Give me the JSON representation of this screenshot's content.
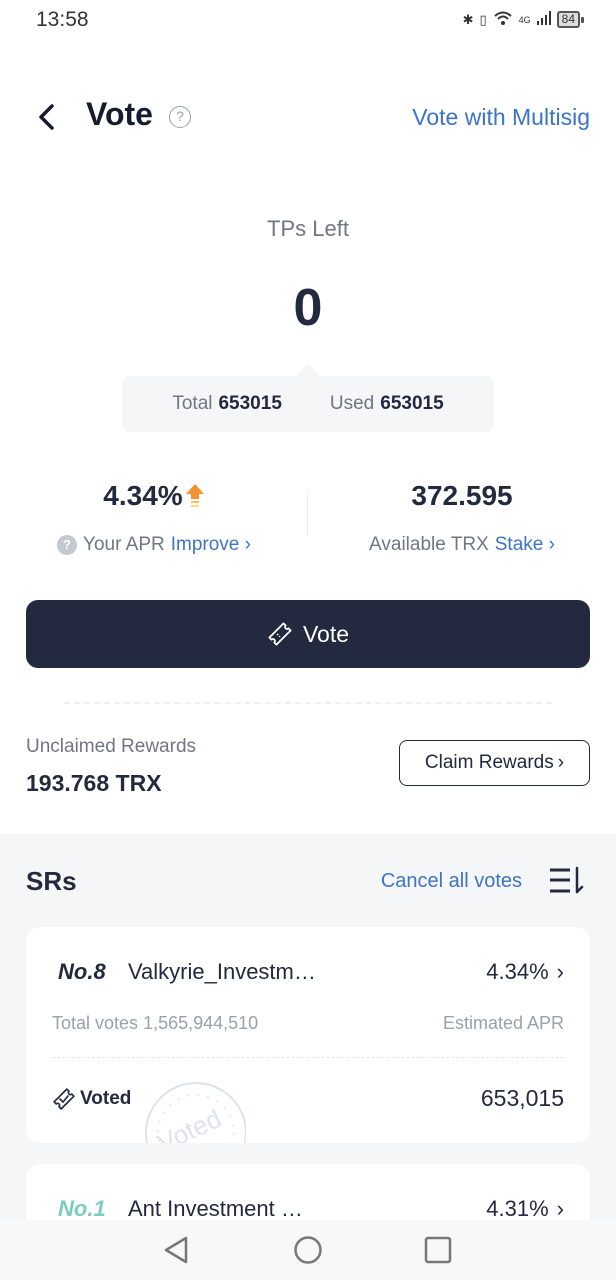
{
  "status_bar": {
    "time": "13:58",
    "network": "4G",
    "battery": "84",
    "icons": [
      "bluetooth-icon",
      "vibrate-icon",
      "wifi-icon",
      "signal-icon",
      "battery-icon"
    ]
  },
  "header": {
    "title": "Vote",
    "multisig_link": "Vote with Multisig"
  },
  "tps": {
    "label": "TPs Left",
    "value": "0",
    "total_label": "Total",
    "total_value": "653015",
    "used_label": "Used",
    "used_value": "653015"
  },
  "stats": {
    "apr_value": "4.34%",
    "apr_label": "Your APR",
    "apr_link": "Improve",
    "trx_value": "372.595",
    "trx_label": "Available TRX",
    "trx_link": "Stake"
  },
  "vote_button": {
    "label": "Vote"
  },
  "rewards": {
    "label": "Unclaimed Rewards",
    "value": "193.768 TRX",
    "claim_button": "Claim Rewards"
  },
  "srs": {
    "title": "SRs",
    "cancel_link": "Cancel all votes",
    "items": [
      {
        "rank": "No.8",
        "name": "Valkyrie_Investm…",
        "apr": "4.34%",
        "total_votes_label": "Total votes",
        "total_votes": "1,565,944,510",
        "apr_label": "Estimated APR",
        "voted_label": "Voted",
        "voted_amount": "653,015",
        "stamp_text": "Voted"
      },
      {
        "rank": "No.1",
        "name": "Ant Investment …",
        "apr": "4.31%"
      }
    ]
  },
  "colors": {
    "primary_dark": "#232a40",
    "link_blue": "#3d74c4",
    "muted_text": "#707682",
    "rank_teal": "#7ccdbf",
    "apr_arrow_orange": "#f5922f",
    "section_bg": "#f5f6f8"
  }
}
